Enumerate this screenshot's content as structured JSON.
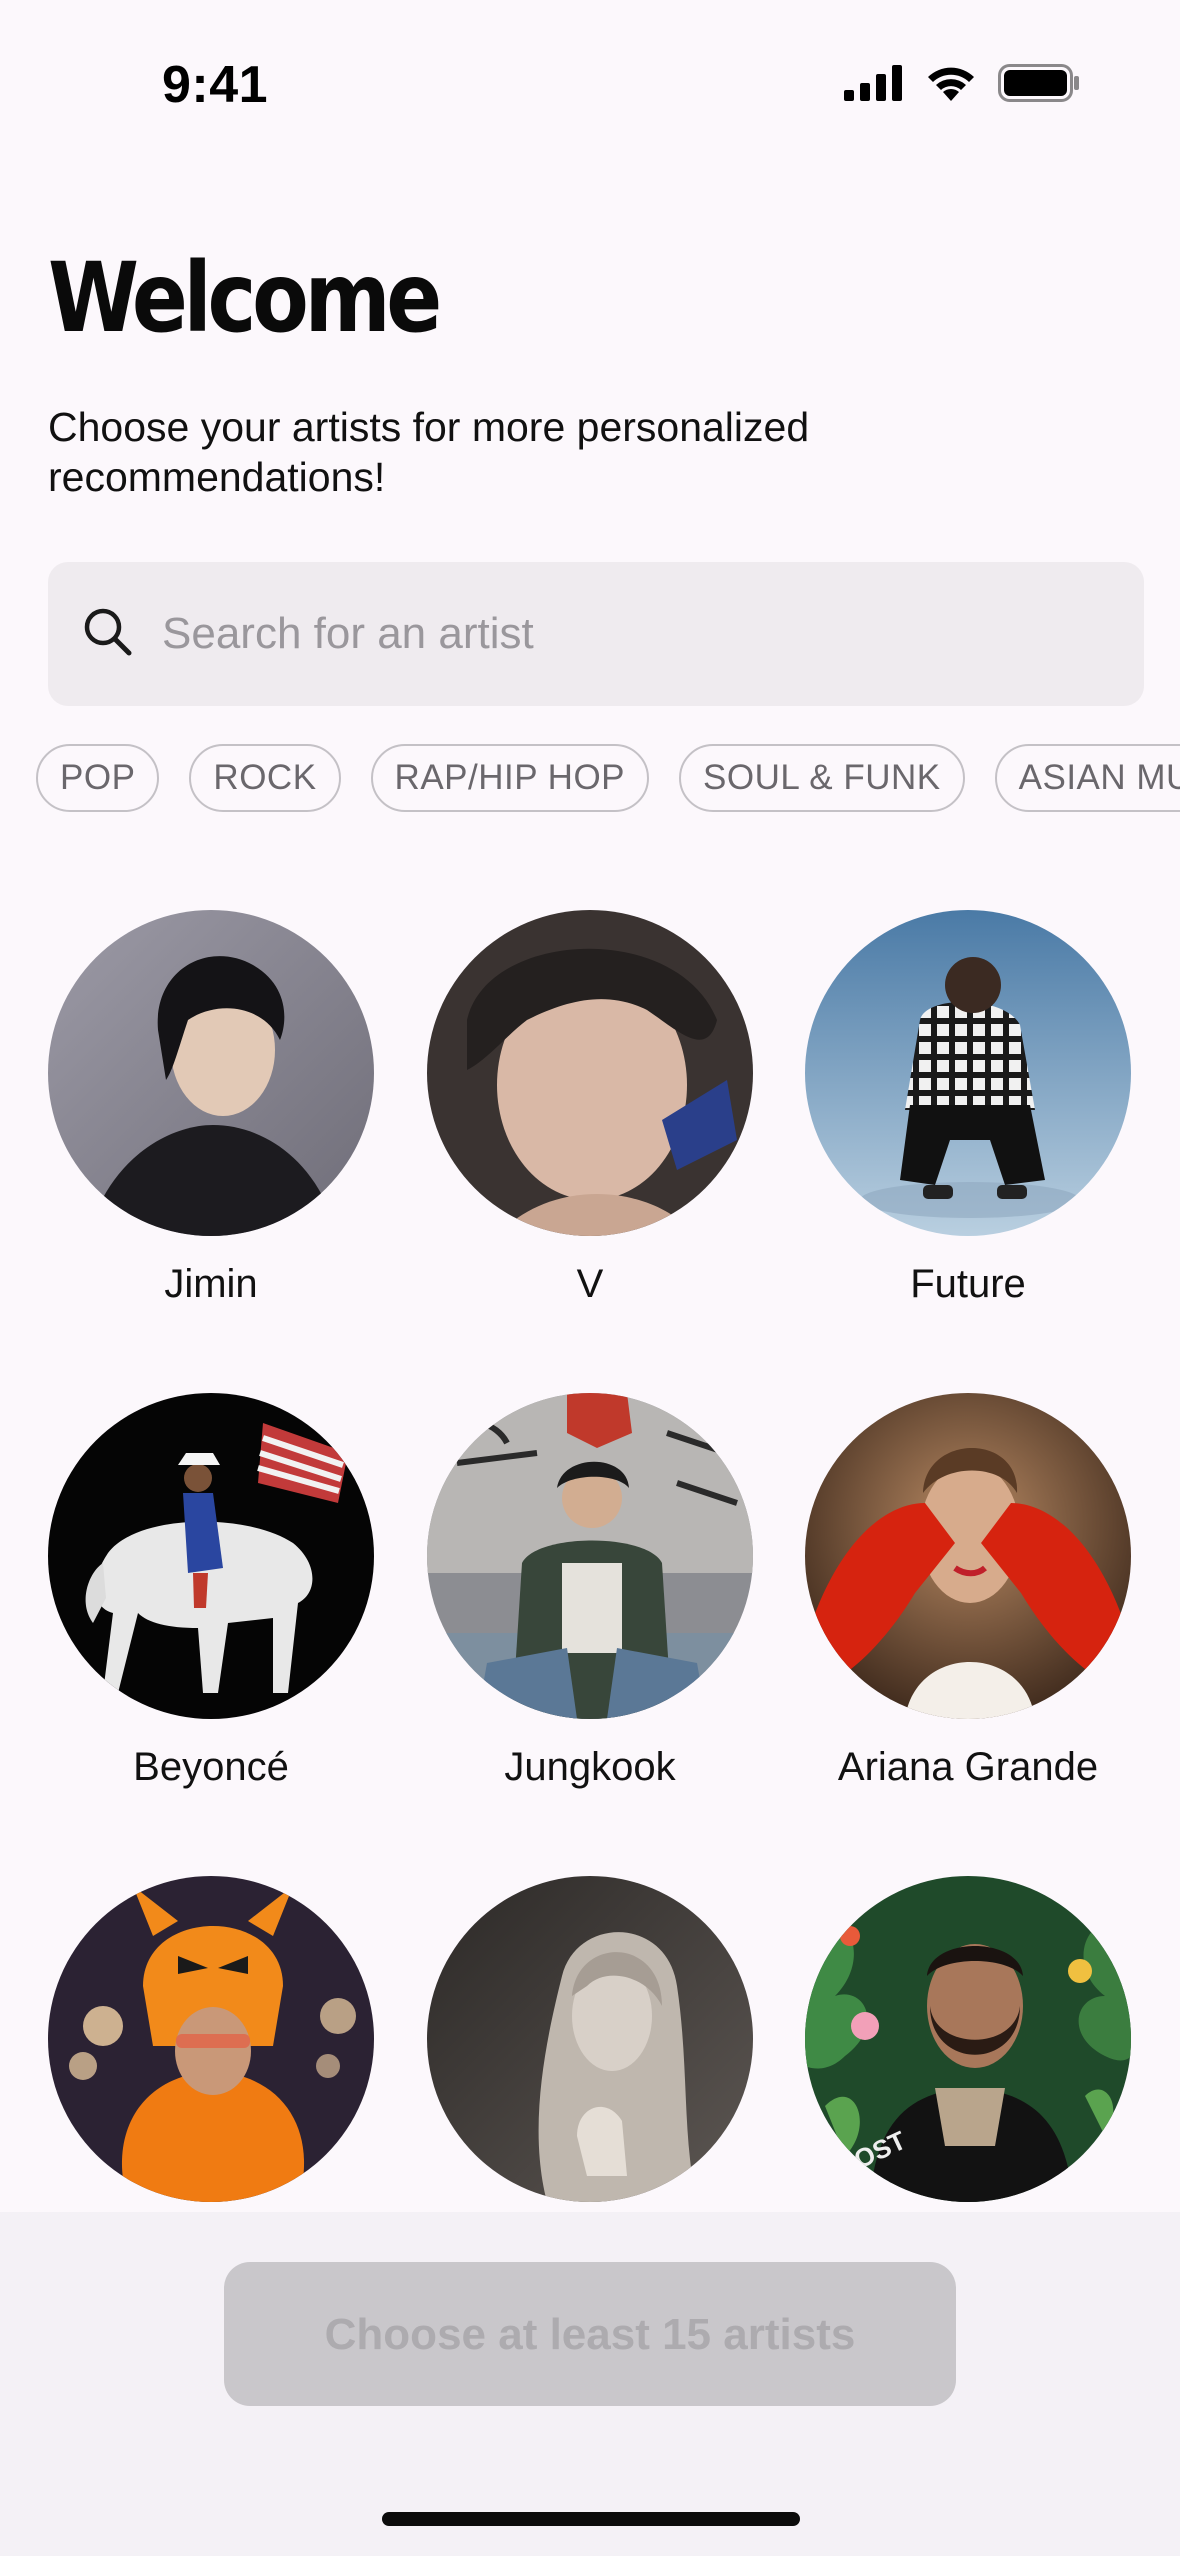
{
  "status_bar": {
    "time": "9:41",
    "icons": [
      "cellular-signal-icon",
      "wifi-icon",
      "battery-icon"
    ]
  },
  "header": {
    "title": "Welcome",
    "subtitle": "Choose your artists for more personalized recommendations!"
  },
  "search": {
    "placeholder": "Search for an artist",
    "value": "",
    "icon": "search-icon"
  },
  "genres": [
    "POP",
    "ROCK",
    "RAP/HIP HOP",
    "SOUL & FUNK",
    "ASIAN MU"
  ],
  "artists": [
    {
      "name": "Jimin"
    },
    {
      "name": "V"
    },
    {
      "name": "Future"
    },
    {
      "name": "Beyoncé"
    },
    {
      "name": "Jungkook"
    },
    {
      "name": "Ariana Grande"
    },
    {
      "name": ""
    },
    {
      "name": ""
    },
    {
      "name": ""
    }
  ],
  "cta": {
    "label": "Choose at least 15 artists",
    "enabled": false
  },
  "colors": {
    "background": "#fcf8fc",
    "search_bg": "#efebef",
    "chip_border": "#c4c1c6",
    "cta_disabled_bg": "#c9c7cb",
    "cta_disabled_text": "#adabaf"
  }
}
